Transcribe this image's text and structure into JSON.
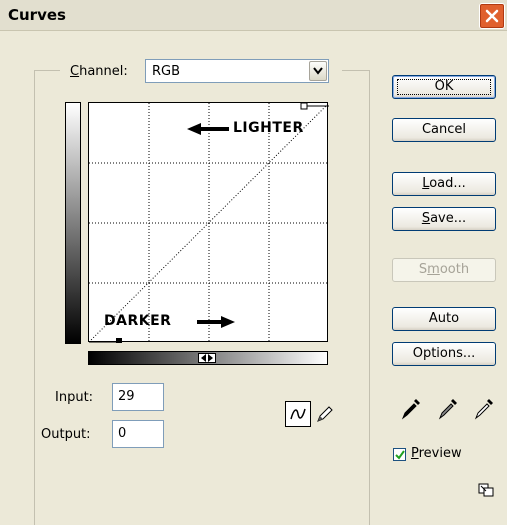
{
  "window": {
    "title": "Curves"
  },
  "channel": {
    "label_prefix": "",
    "label_mnemonic": "C",
    "label_rest": "hannel:",
    "value": "RGB"
  },
  "graph": {
    "lighter_label": "LIGHTER",
    "darker_label": "DARKER",
    "grid_divisions": 4
  },
  "curve": {
    "start": [
      0,
      0
    ],
    "end": [
      255,
      255
    ],
    "active_point_input": 29,
    "active_point_output": 0
  },
  "input": {
    "label": "Input:",
    "value": "29"
  },
  "output": {
    "label": "Output:",
    "value": "0"
  },
  "buttons": {
    "ok": "OK",
    "cancel": "Cancel",
    "load_mnemonic": "L",
    "load_rest": "oad...",
    "save_mnemonic": "S",
    "save_rest": "ave...",
    "smooth_a": "S",
    "smooth_mnemonic": "m",
    "smooth_rest": "ooth",
    "auto": "Auto",
    "options": "Options..."
  },
  "preview": {
    "checked": true,
    "mnemonic": "P",
    "rest": "review"
  },
  "icons": {
    "close": "close-icon",
    "black_eyedropper": "black-eyedropper-icon",
    "gray_eyedropper": "gray-eyedropper-icon",
    "white_eyedropper": "white-eyedropper-icon",
    "curve_tool": "curve-tool-icon",
    "pencil_tool": "pencil-tool-icon",
    "resize": "expand-dialog-icon"
  },
  "colors": {
    "close_button": "#e0602e",
    "title_bar": "#e2dfcf",
    "dialog_bg": "#ece9d8"
  }
}
